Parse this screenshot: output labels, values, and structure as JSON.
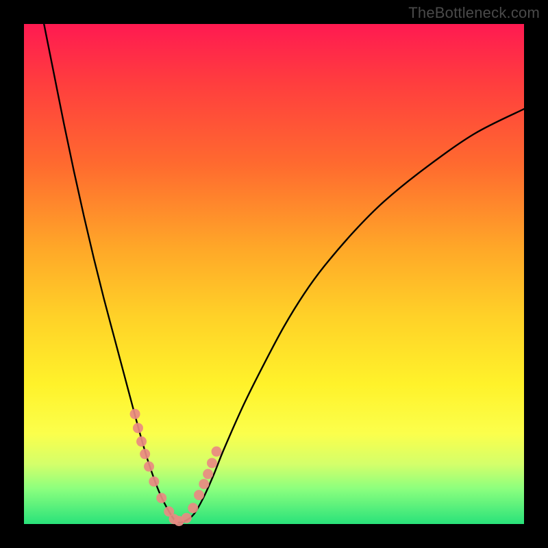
{
  "watermark": "TheBottleneck.com",
  "chart_data": {
    "type": "line",
    "title": "",
    "xlabel": "",
    "ylabel": "",
    "xlim": [
      0,
      100
    ],
    "ylim": [
      0,
      100
    ],
    "series": [
      {
        "name": "bottleneck-curve",
        "x": [
          4,
          6,
          8,
          10,
          12,
          14,
          16,
          18,
          20,
          22,
          23.5,
          25,
          27,
          29,
          30.5,
          32,
          34,
          36,
          38,
          40,
          44,
          48,
          52,
          56,
          60,
          66,
          72,
          80,
          90,
          100
        ],
        "values": [
          100,
          90,
          80,
          70.5,
          61.5,
          53,
          45,
          37.5,
          30,
          22.5,
          17,
          12,
          6.5,
          2.5,
          0.5,
          0.5,
          2,
          5.5,
          10,
          15,
          24,
          32,
          39.5,
          46,
          51.5,
          58.5,
          64.5,
          71,
          78,
          83
        ]
      }
    ],
    "markers": {
      "name": "highlighted-points",
      "x": [
        22.2,
        22.8,
        23.5,
        24.2,
        25.0,
        26.0,
        27.5,
        29.0,
        30.0,
        31.0,
        32.5,
        33.8,
        35.0,
        36.0,
        36.8,
        37.6,
        38.5
      ],
      "values": [
        22.0,
        19.2,
        16.5,
        14.0,
        11.5,
        8.5,
        5.2,
        2.5,
        1.0,
        0.6,
        1.2,
        3.2,
        5.8,
        8.0,
        10.0,
        12.2,
        14.5
      ]
    },
    "gradient_bands": {
      "description": "Vertical heatmap: red (top, high bottleneck) to green (bottom, low bottleneck)",
      "stops": [
        {
          "pos": 0.0,
          "color": "#ff1a51"
        },
        {
          "pos": 0.12,
          "color": "#ff3e3e"
        },
        {
          "pos": 0.28,
          "color": "#ff6a2f"
        },
        {
          "pos": 0.45,
          "color": "#ffa828"
        },
        {
          "pos": 0.58,
          "color": "#ffd028"
        },
        {
          "pos": 0.72,
          "color": "#fff22a"
        },
        {
          "pos": 0.82,
          "color": "#fbff4c"
        },
        {
          "pos": 0.88,
          "color": "#d4ff6a"
        },
        {
          "pos": 0.93,
          "color": "#8bff7e"
        },
        {
          "pos": 1.0,
          "color": "#29e27a"
        }
      ]
    },
    "marker_color": "#e98a82"
  }
}
